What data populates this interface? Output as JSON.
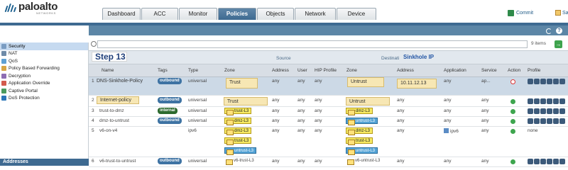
{
  "brand": {
    "name": "paloalto",
    "sub": "NETWORKS"
  },
  "tabs": [
    {
      "label": "Dashboard",
      "active": false
    },
    {
      "label": "ACC",
      "active": false
    },
    {
      "label": "Monitor",
      "active": false
    },
    {
      "label": "Policies",
      "active": true
    },
    {
      "label": "Objects",
      "active": false
    },
    {
      "label": "Network",
      "active": false
    },
    {
      "label": "Device",
      "active": false
    }
  ],
  "actions": {
    "commit": "Commit",
    "save": "Sa"
  },
  "sidebar": {
    "items": [
      {
        "label": "Security",
        "icon": "security-icon",
        "selected": true
      },
      {
        "label": "NAT",
        "icon": "nat-icon",
        "selected": false
      },
      {
        "label": "QoS",
        "icon": "qos-icon",
        "selected": false
      },
      {
        "label": "Policy Based Forwarding",
        "icon": "pbf-icon",
        "selected": false
      },
      {
        "label": "Decryption",
        "icon": "decryption-icon",
        "selected": false
      },
      {
        "label": "Application Override",
        "icon": "app-override-icon",
        "selected": false
      },
      {
        "label": "Captive Portal",
        "icon": "captive-portal-icon",
        "selected": false
      },
      {
        "label": "DoS Protection",
        "icon": "dos-icon",
        "selected": false
      }
    ],
    "footer": "Addresses"
  },
  "search": {
    "count": "9 items",
    "go": "→"
  },
  "annotations": {
    "step": "Step 13",
    "sinkhole": "Sinkhole IP"
  },
  "groups": {
    "source": "Source",
    "destination": "Destinati"
  },
  "columns": {
    "name": "Name",
    "tags": "Tags",
    "type": "Type",
    "src_zone": "Zone",
    "src_address": "Address",
    "user": "User",
    "hip": "HIP Profile",
    "dst_zone": "Zone",
    "dst_address": "Address",
    "application": "Application",
    "service": "Service",
    "action": "Action",
    "profile": "Profile"
  },
  "rows": [
    {
      "num": "1",
      "name": "DNS-Sinkhole-Policy",
      "tag": "outbound",
      "type": "universal",
      "src_zone": "Trust",
      "src_address": "any",
      "user": "any",
      "hip": "any",
      "dst_zone": "Untrust",
      "dst_address": "10.11.12.13",
      "application": "any",
      "service": "ap...",
      "action": "deny",
      "profile": "icons"
    },
    {
      "num": "2",
      "name": "Internet-policy",
      "tag": "outbound",
      "type": "universal",
      "src_zone": "Trust",
      "src_address": "any",
      "user": "any",
      "hip": "any",
      "dst_zone": "Untrust",
      "dst_address": "any",
      "application": "any",
      "service": "any",
      "action": "allow",
      "profile": "icons"
    },
    {
      "num": "3",
      "name": "trust-to-dmz",
      "tag": "internal",
      "type": "universal",
      "src_zone": "trust-L3",
      "src_address": "any",
      "user": "any",
      "hip": "any",
      "dst_zone": "dmz-L3",
      "dst_address": "any",
      "application": "any",
      "service": "any",
      "action": "allow",
      "profile": "icons"
    },
    {
      "num": "4",
      "name": "dmz-to-untrust",
      "tag": "outbound",
      "type": "universal",
      "src_zone": "dmz-L3",
      "src_address": "any",
      "user": "any",
      "hip": "any",
      "dst_zone": "untrust-L3",
      "dst_address": "any",
      "application": "any",
      "service": "any",
      "action": "allow",
      "profile": "icons"
    },
    {
      "num": "5",
      "name": "v6-on-v4",
      "tag": "",
      "type": "ipv6",
      "src_zones": [
        "dmz-L3",
        "trust-L3",
        "untrust-L3"
      ],
      "dst_zones": [
        "dmz-L3",
        "trust-L3",
        "untrust-L3"
      ],
      "src_address": "any",
      "user": "any",
      "hip": "any",
      "dst_address": "any",
      "application": "ipv6",
      "service": "any",
      "action": "allow",
      "profile": "none"
    },
    {
      "num": "6",
      "name": "v6-trust-to-untrust",
      "tag": "outbound",
      "type": "universal",
      "src_zone": "v6-trust-L3",
      "src_address": "any",
      "user": "any",
      "hip": "any",
      "dst_zone": "v6-untrust-L3",
      "dst_address": "any",
      "application": "any",
      "service": "any",
      "action": "allow",
      "profile": "icons"
    }
  ]
}
